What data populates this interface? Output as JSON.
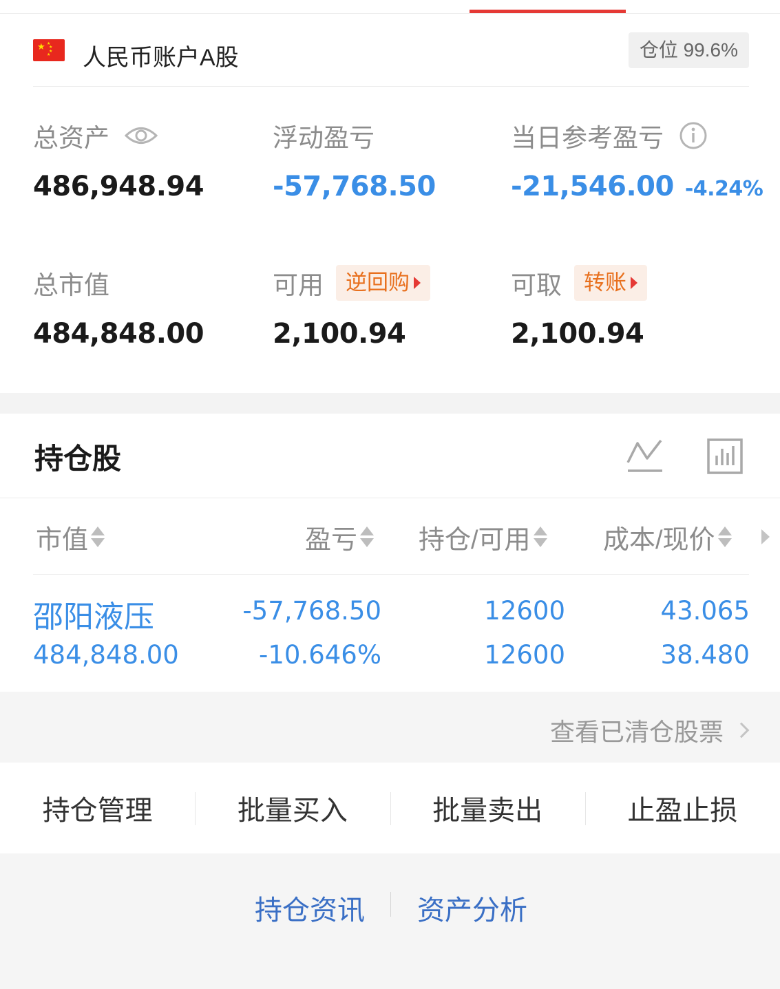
{
  "account": {
    "name": "人民币账户A股",
    "position_label": "仓位 99.6%"
  },
  "summary": {
    "total_assets_label": "总资产",
    "total_assets_value": "486,948.94",
    "floating_pl_label": "浮动盈亏",
    "floating_pl_value": "-57,768.50",
    "daily_pl_label": "当日参考盈亏",
    "daily_pl_value": "-21,546.00",
    "daily_pl_pct": "-4.24%",
    "market_value_label": "总市值",
    "market_value_value": "484,848.00",
    "available_label": "可用",
    "reverse_repo_label": "逆回购",
    "available_value": "2,100.94",
    "withdrawable_label": "可取",
    "transfer_label": "转账",
    "withdrawable_value": "2,100.94"
  },
  "holdings": {
    "title": "持仓股",
    "columns": [
      "市值",
      "盈亏",
      "持仓/可用",
      "成本/现价"
    ],
    "rows": [
      {
        "name": "邵阳液压",
        "market_value": "484,848.00",
        "pl": "-57,768.50",
        "pl_pct": "-10.646%",
        "position": "12600",
        "available": "12600",
        "cost": "43.065",
        "price": "38.480"
      }
    ],
    "cleared_link": "查看已清仓股票"
  },
  "actions": [
    "持仓管理",
    "批量买入",
    "批量卖出",
    "止盈止损"
  ],
  "footer_links": [
    "持仓资讯",
    "资产分析"
  ],
  "colors": {
    "accent_red": "#e53935",
    "loss_blue": "#3a8ee6",
    "pill_orange": "#e8701e",
    "link_blue": "#3a6fc5"
  },
  "icons": [
    "eye-icon",
    "info-icon",
    "line-chart-icon",
    "bar-chart-icon",
    "sort-icon",
    "chevron-right-icon",
    "china-flag-icon"
  ]
}
